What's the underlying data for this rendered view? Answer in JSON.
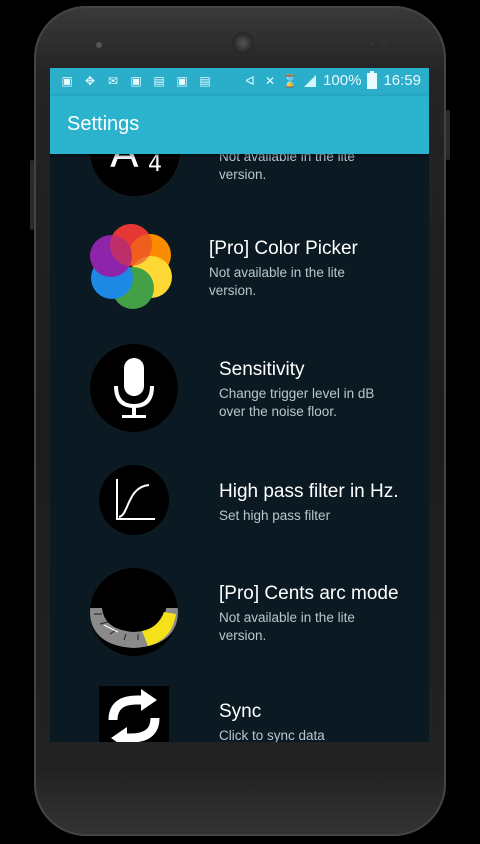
{
  "status_bar": {
    "battery_percent": "100%",
    "time": "16:59",
    "left_icons": [
      "gallery-icon",
      "pinwheel-icon",
      "mail-icon",
      "gallery-icon",
      "chart-icon",
      "message-icon",
      "photo-icon"
    ],
    "right_icons": [
      "bluetooth-icon",
      "mute-icon",
      "alarm-icon",
      "signal-icon"
    ]
  },
  "toolbar": {
    "title": "Settings"
  },
  "settings": {
    "items": [
      {
        "title": "",
        "subtitle": "Not available in the lite version.",
        "subtitle_lines": [
          "Not available in the lite",
          "version."
        ],
        "icon": "note-a4-icon"
      },
      {
        "title": "[Pro] Color Picker",
        "subtitle_lines": [
          "Not available in the lite",
          "version."
        ],
        "icon": "color-flower-icon"
      },
      {
        "title": "Sensitivity",
        "subtitle_lines": [
          "Change trigger level in dB",
          "over the noise floor."
        ],
        "icon": "microphone-icon"
      },
      {
        "title": "High pass filter in Hz.",
        "subtitle_lines": [
          "Set high pass filter"
        ],
        "icon": "filter-curve-icon"
      },
      {
        "title": "[Pro] Cents arc mode",
        "subtitle_lines": [
          "Not available in the lite",
          "version."
        ],
        "icon": "cents-arc-icon"
      },
      {
        "title": "Sync",
        "subtitle_lines": [
          "Click to sync data"
        ],
        "icon": "sync-icon"
      }
    ],
    "note_label": "A",
    "note_subscript": "4"
  },
  "colors": {
    "accent": "#2bb2cc",
    "background": "#0b1a22"
  }
}
